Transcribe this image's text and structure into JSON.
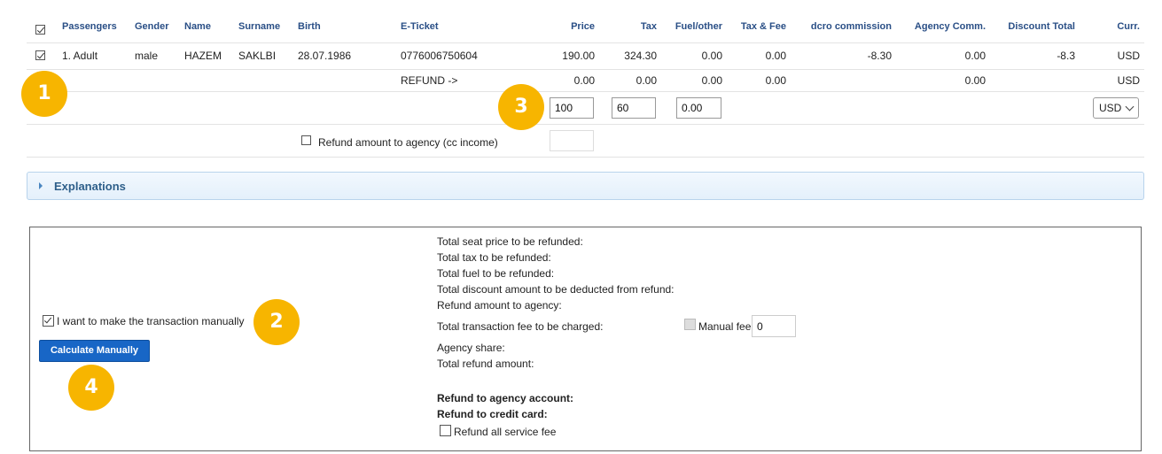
{
  "table": {
    "headers": {
      "passengers": "Passengers",
      "gender": "Gender",
      "name": "Name",
      "surname": "Surname",
      "birth": "Birth",
      "eticket": "E-Ticket",
      "price": "Price",
      "tax": "Tax",
      "fuel": "Fuel/other",
      "taxfee": "Tax & Fee",
      "dcro": "dcro commission",
      "agency": "Agency Comm.",
      "discount": "Discount Total",
      "curr": "Curr."
    },
    "row": {
      "passenger": "1. Adult",
      "gender": "male",
      "name": "HAZEM",
      "surname": "SAKLBI",
      "birth": "28.07.1986",
      "eticket": "0776006750604",
      "price": "190.00",
      "tax": "324.30",
      "fuel": "0.00",
      "taxfee": "0.00",
      "dcro": "-8.30",
      "agency": "0.00",
      "discount": "-8.3",
      "curr": "USD"
    },
    "refund_row": {
      "label": "REFUND ->",
      "price": "0.00",
      "tax": "0.00",
      "fuel": "0.00",
      "taxfee": "0.00",
      "agency": "0.00",
      "curr": "USD"
    },
    "inputs": {
      "price": "100",
      "tax": "60",
      "fuel": "0.00",
      "currency": "USD"
    },
    "refund_agency_label": "Refund amount to agency (cc income)"
  },
  "explanations": {
    "label": "Explanations"
  },
  "manual": {
    "checkbox_label": "I want to make the transaction manually",
    "button_label": "Calculate Manually"
  },
  "summary": {
    "seat_price": "Total seat price to be refunded:",
    "tax": "Total tax to be refunded:",
    "fuel": "Total fuel to be refunded:",
    "discount": "Total discount amount to be deducted from refund:",
    "agency_amount": "Refund amount to agency:",
    "transaction_fee": "Total transaction fee to be charged:",
    "manual_fee_label": "Manual fee",
    "manual_fee_value": "0",
    "agency_share": "Agency share:",
    "total_refund": "Total refund amount:",
    "agency_account": "Refund to agency account:",
    "credit_card": "Refund to credit card:",
    "service_fee": "Refund all service fee"
  },
  "badges": {
    "b1": "1",
    "b2": "2",
    "b3": "3",
    "b4": "4"
  },
  "colors": {
    "header_text": "#2a4f86",
    "badge": "#f7b500",
    "button": "#1866c6"
  }
}
